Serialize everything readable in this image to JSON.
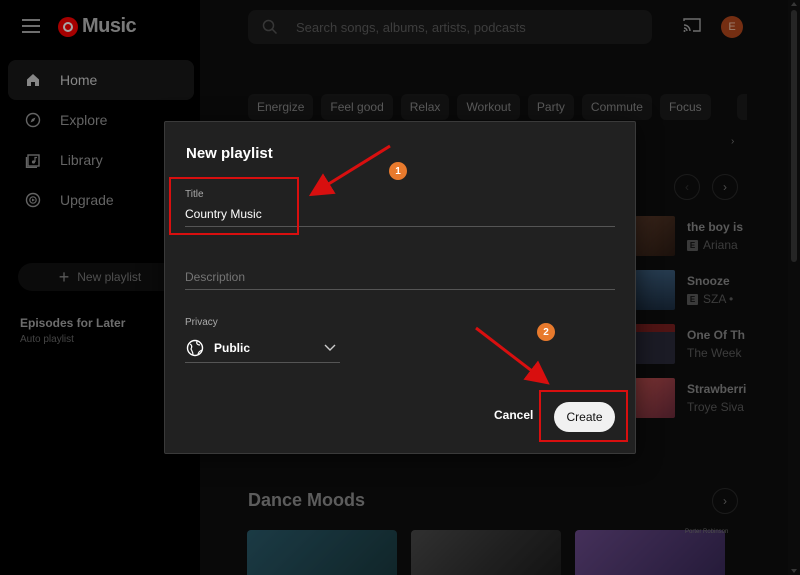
{
  "app": {
    "logo_text": "Music",
    "avatar_initial": "E"
  },
  "sidebar": {
    "items": [
      {
        "label": "Home",
        "icon": "home-icon"
      },
      {
        "label": "Explore",
        "icon": "compass-icon"
      },
      {
        "label": "Library",
        "icon": "library-icon"
      },
      {
        "label": "Upgrade",
        "icon": "upgrade-icon"
      }
    ],
    "new_playlist": "New playlist",
    "episodes_title": "Episodes for Later",
    "episodes_sub": "Auto playlist"
  },
  "search": {
    "placeholder": "Search songs, albums, artists, podcasts"
  },
  "chips": [
    "Energize",
    "Feel good",
    "Relax",
    "Workout",
    "Party",
    "Commute",
    "Focus"
  ],
  "songs": [
    {
      "title": "the boy is",
      "artist": "Ariana",
      "explicit": true
    },
    {
      "title": "Snooze",
      "artist": "SZA •",
      "explicit": true
    },
    {
      "title": "One Of Th",
      "artist": "The Week",
      "explicit": false
    },
    {
      "title": "Strawberri",
      "artist": "Troye Siva",
      "explicit": false
    }
  ],
  "section": {
    "dance_moods": "Dance Moods",
    "card_caption": "Porter Robinson"
  },
  "dialog": {
    "title": "New playlist",
    "title_label": "Title",
    "title_value": "Country Music",
    "description_placeholder": "Description",
    "privacy_label": "Privacy",
    "privacy_value": "Public",
    "cancel": "Cancel",
    "create": "Create"
  },
  "annotations": {
    "step1": "1",
    "step2": "2",
    "color": "#d80f0f",
    "badge_color": "#e87a2d"
  }
}
